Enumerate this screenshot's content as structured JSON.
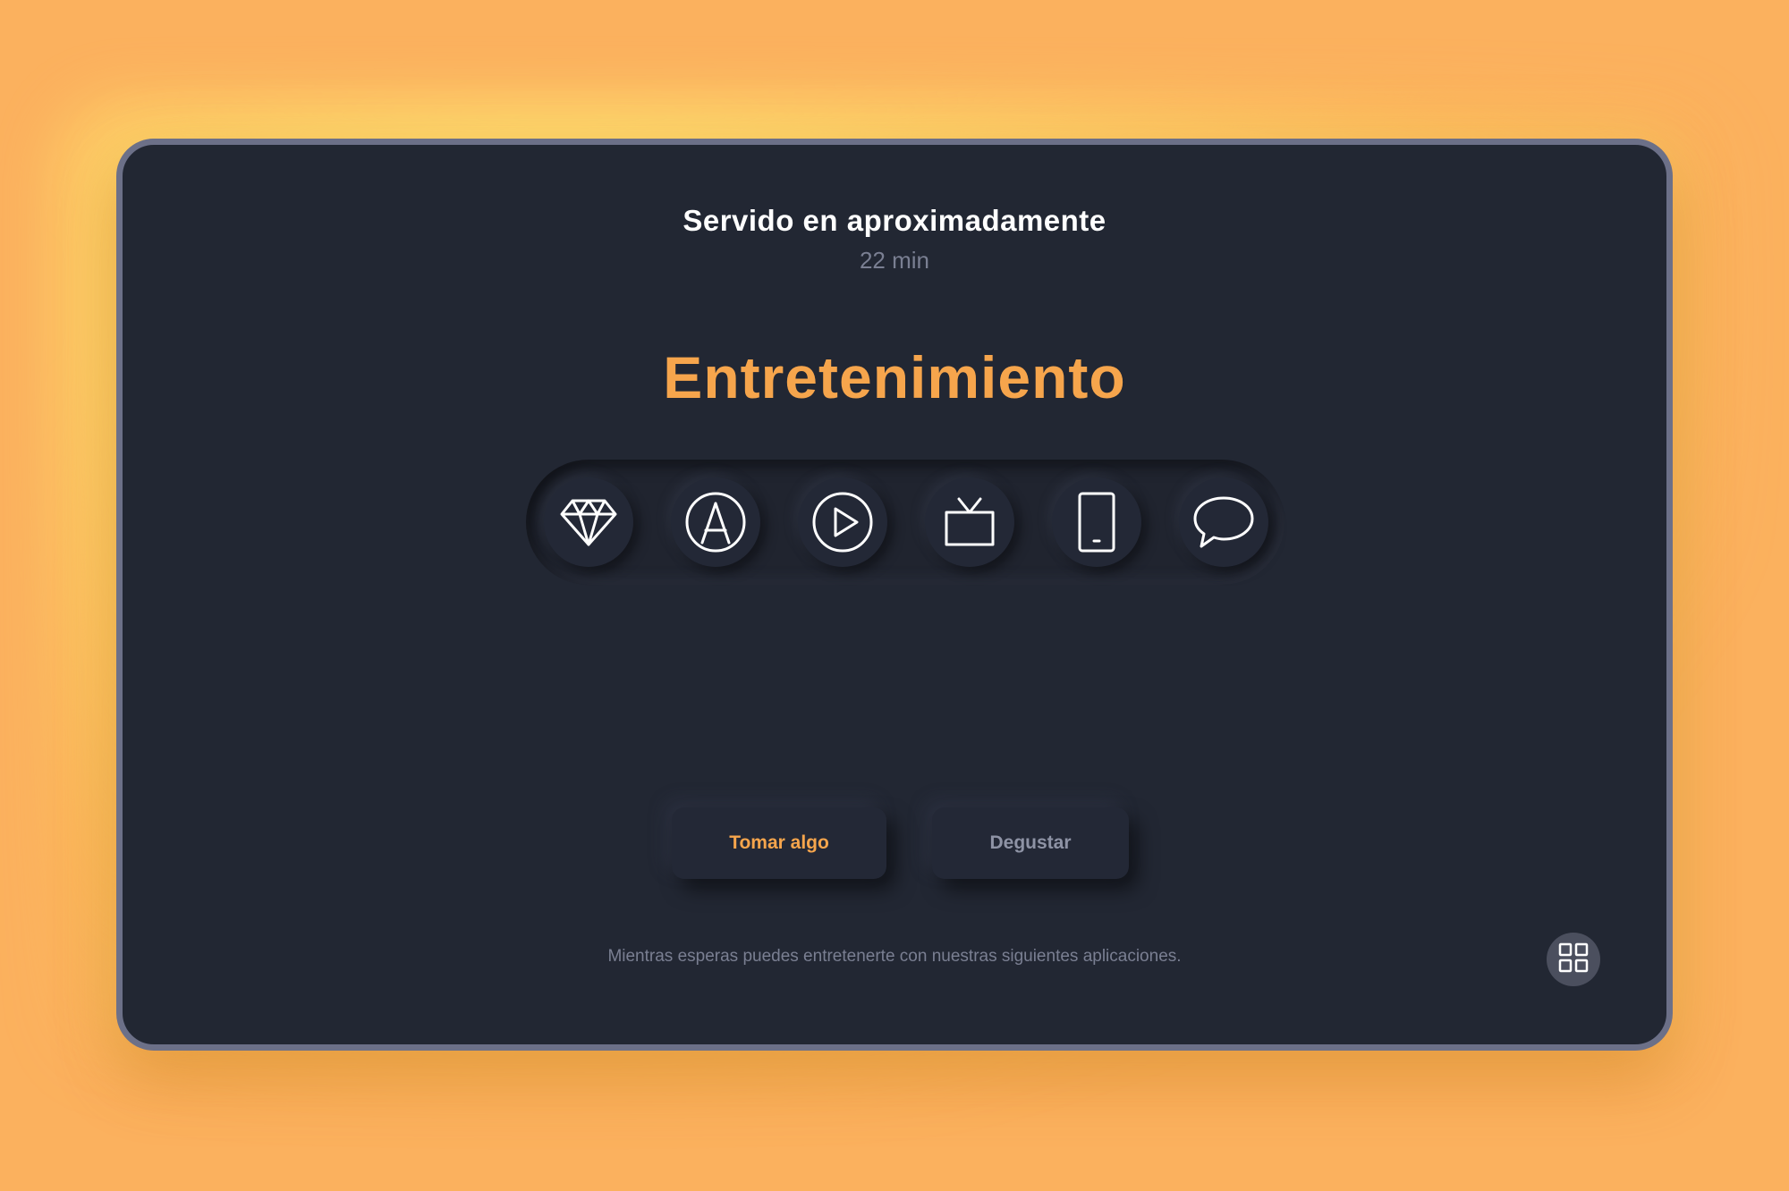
{
  "header": {
    "title": "Servido en aproximadamente",
    "wait_time": "22 min"
  },
  "main": {
    "title": "Entretenimiento",
    "apps": [
      {
        "icon": "diamond-icon"
      },
      {
        "icon": "app-store-icon"
      },
      {
        "icon": "play-icon"
      },
      {
        "icon": "tv-icon"
      },
      {
        "icon": "phone-icon"
      },
      {
        "icon": "chat-bubble-icon"
      }
    ]
  },
  "actions": {
    "primary_label": "Tomar algo",
    "secondary_label": "Degustar"
  },
  "footer": {
    "message": "Mientras esperas puedes entretenerte con nuestras siguientes aplicaciones.",
    "grid_icon": "grid-icon"
  },
  "colors": {
    "background": "#fbb15e",
    "panel": "#222733",
    "accent": "#f6a54c",
    "text": "#ffffff",
    "muted": "#7a7f92"
  }
}
